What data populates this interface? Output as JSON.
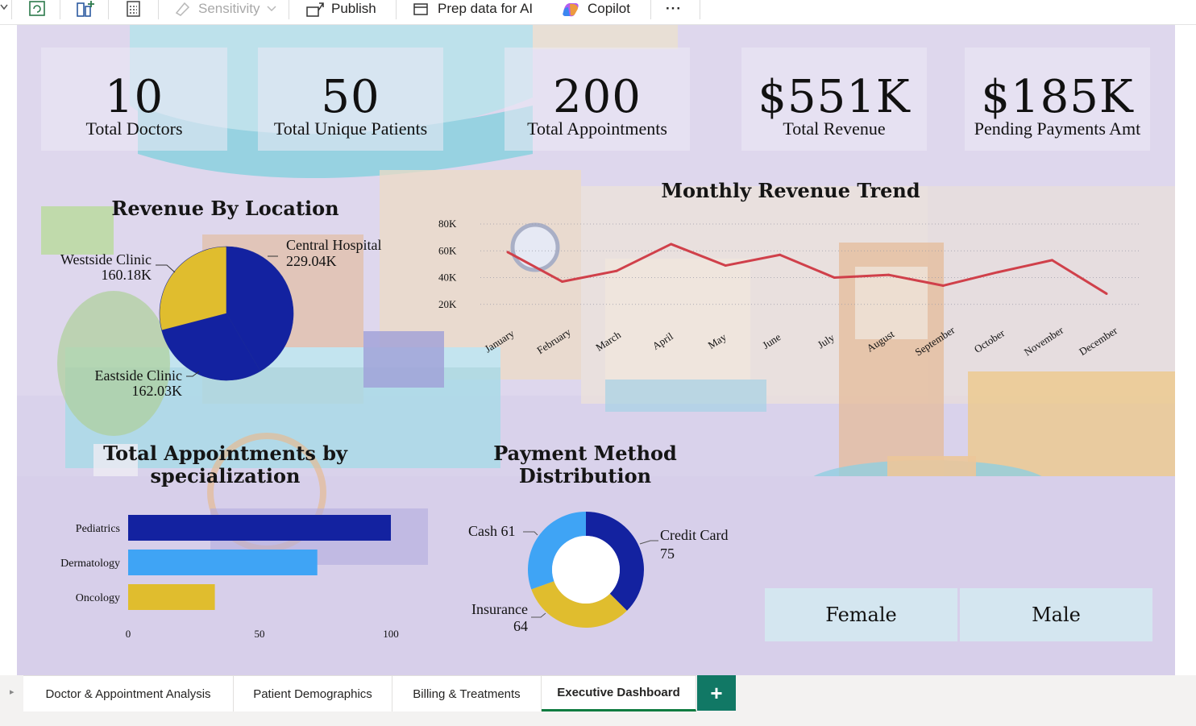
{
  "toolbar": {
    "sensitivity": "Sensitivity",
    "publish": "Publish",
    "prep_data": "Prep data for AI",
    "copilot": "Copilot",
    "more": "···"
  },
  "kpis": [
    {
      "value": "10",
      "label": "Total Doctors"
    },
    {
      "value": "50",
      "label": "Total Unique Patients"
    },
    {
      "value": "200",
      "label": "Total Appointments"
    },
    {
      "value": "$551K",
      "label": "Total Revenue"
    },
    {
      "value": "$185K",
      "label": "Pending Payments Amt"
    }
  ],
  "gender_slicer": {
    "female": "Female",
    "male": "Male"
  },
  "tabs": [
    {
      "label": "Doctor & Appointment Analysis"
    },
    {
      "label": "Patient Demographics"
    },
    {
      "label": "Billing & Treatments"
    },
    {
      "label": "Executive Dashboard"
    }
  ],
  "tab_add": "+",
  "chart_data": [
    {
      "type": "pie",
      "title": "Revenue By Location",
      "slices": [
        {
          "name": "Central Hospital",
          "label": "229.04K",
          "value": 229.04,
          "color": "#1322a0"
        },
        {
          "name": "Eastside Clinic",
          "label": "162.03K",
          "value": 162.03,
          "color": "#1322a0"
        },
        {
          "name": "Westside Clinic",
          "label": "160.18K",
          "value": 160.18,
          "color": "#e0bd2e"
        }
      ]
    },
    {
      "type": "line",
      "title": "Monthly Revenue Trend",
      "categories": [
        "January",
        "February",
        "March",
        "April",
        "May",
        "June",
        "July",
        "August",
        "September",
        "October",
        "November",
        "December"
      ],
      "values": [
        59000,
        37000,
        45000,
        65000,
        49000,
        57000,
        40000,
        42000,
        34000,
        44000,
        53000,
        28000
      ],
      "ylim": [
        0,
        80000
      ],
      "yticks": [
        "20K",
        "40K",
        "60K",
        "80K"
      ],
      "color": "#d0404a"
    },
    {
      "type": "bar",
      "orientation": "horizontal",
      "title": "Total Appointments by specialization",
      "categories": [
        "Pediatrics",
        "Dermatology",
        "Oncology"
      ],
      "values": [
        100,
        72,
        33
      ],
      "colors": [
        "#1322a0",
        "#3fa4f5",
        "#e0bd2e"
      ],
      "xlim": [
        0,
        100
      ],
      "xticks": [
        "0",
        "50",
        "100"
      ]
    },
    {
      "type": "pie",
      "subtype": "donut",
      "title": "Payment Method Distribution",
      "slices": [
        {
          "name": "Credit Card",
          "value": 75,
          "color": "#1322a0"
        },
        {
          "name": "Insurance",
          "value": 64,
          "color": "#e0bd2e"
        },
        {
          "name": "Cash",
          "value": 61,
          "color": "#3fa4f5"
        }
      ]
    }
  ]
}
